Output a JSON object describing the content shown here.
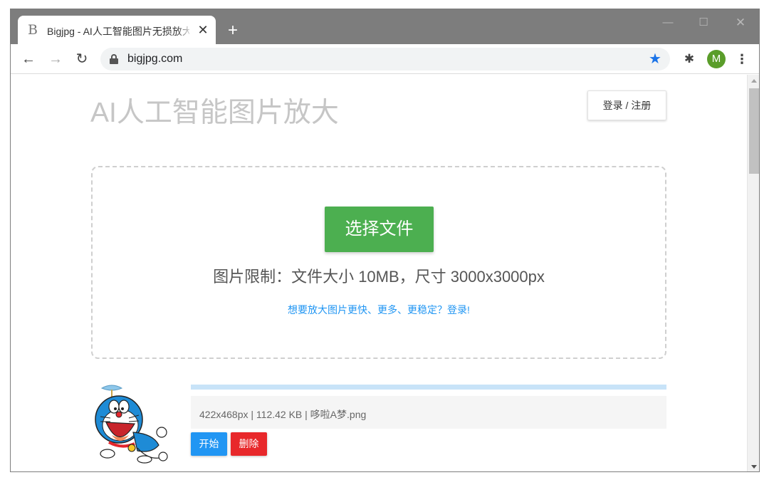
{
  "browser": {
    "tab": {
      "favicon_glyph": "B",
      "title": "Bigjpg - AI人工智能图片无损放大",
      "close_glyph": "✕"
    },
    "new_tab_glyph": "+",
    "window_controls": {
      "minimize": "—",
      "maximize": "☐",
      "close": "✕"
    },
    "nav": {
      "back": "←",
      "forward": "→",
      "reload": "↻"
    },
    "omnibox": {
      "url": "bigjpg.com",
      "star_glyph": "★",
      "star_color": "#1a73e8"
    },
    "extensions_glyph": "✱",
    "profile": {
      "initial": "M",
      "color": "#5a9d2a"
    },
    "menu_glyph": "⋮"
  },
  "page": {
    "title": "AI人工智能图片放大",
    "login_button": "登录 / 注册",
    "upload": {
      "choose_button": "选择文件",
      "limits": "图片限制：文件大小 10MB，尺寸 3000x3000px",
      "hint_link": "想要放大图片更快、更多、更稳定？登录!"
    },
    "file": {
      "thumbnail": "doraemon-image",
      "progress": 0,
      "info": "422x468px | 112.42 KB | 哆啦A梦.png",
      "start_button": "开始",
      "delete_button": "删除"
    }
  },
  "colors": {
    "accent_green": "#4caf50",
    "accent_blue": "#2196f3",
    "danger_red": "#e8282b"
  }
}
